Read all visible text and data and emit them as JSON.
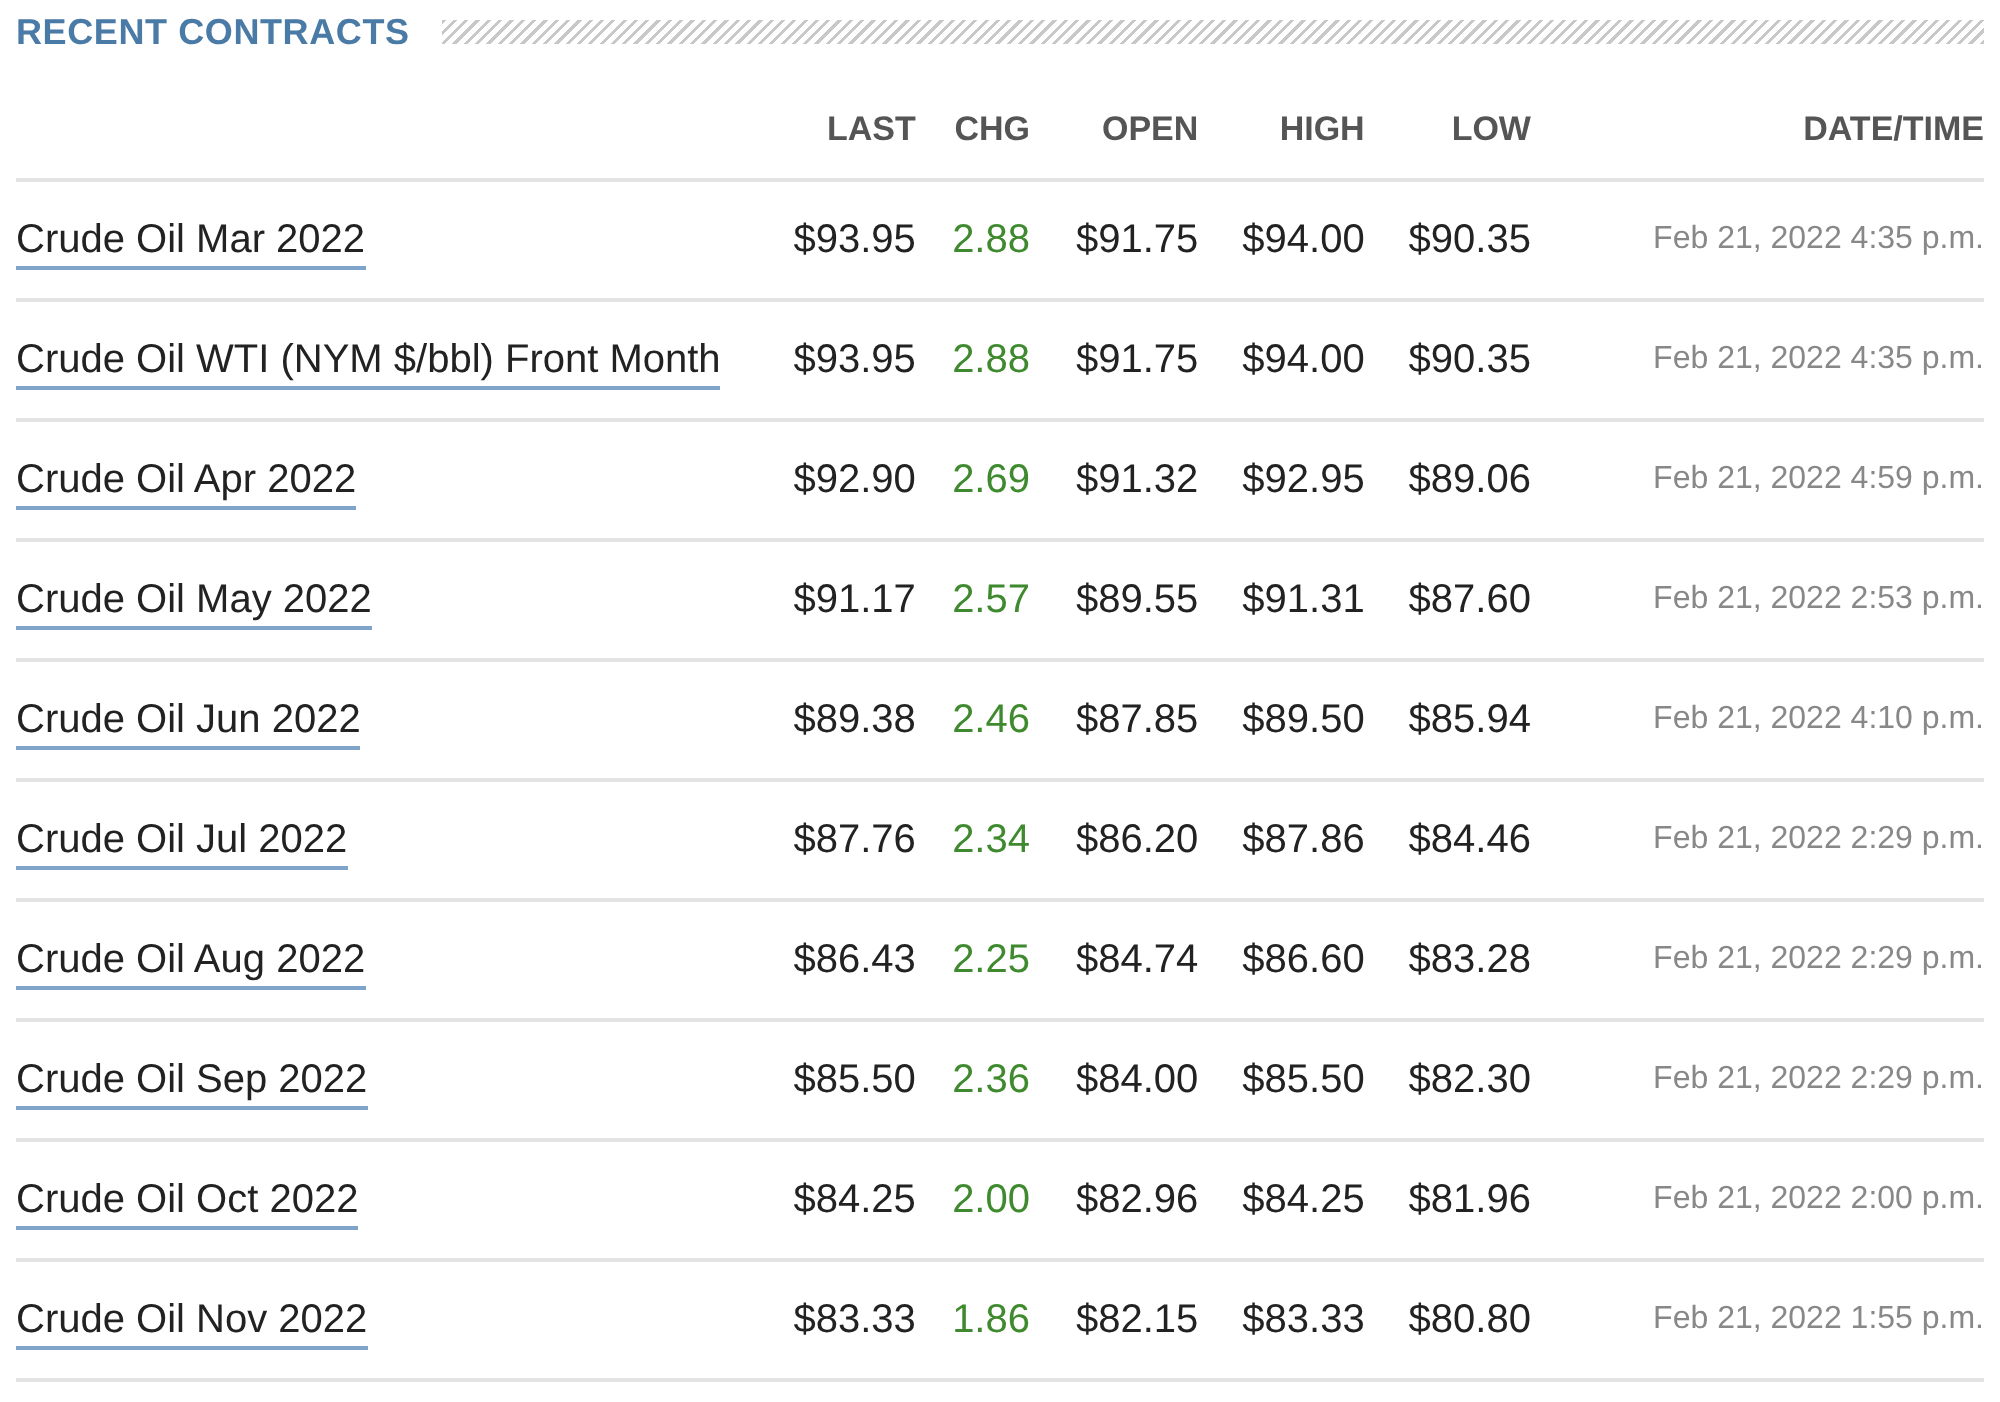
{
  "section_title": "RECENT CONTRACTS",
  "table": {
    "columns": [
      "LAST",
      "CHG",
      "OPEN",
      "HIGH",
      "LOW",
      "DATE/TIME"
    ],
    "rows": [
      {
        "name": "Crude Oil Mar 2022",
        "last": "$93.95",
        "chg": "2.88",
        "open": "$91.75",
        "high": "$94.00",
        "low": "$90.35",
        "datetime": "Feb 21, 2022 4:35 p.m."
      },
      {
        "name": "Crude Oil WTI (NYM $/bbl) Front Month",
        "last": "$93.95",
        "chg": "2.88",
        "open": "$91.75",
        "high": "$94.00",
        "low": "$90.35",
        "datetime": "Feb 21, 2022 4:35 p.m."
      },
      {
        "name": "Crude Oil Apr 2022",
        "last": "$92.90",
        "chg": "2.69",
        "open": "$91.32",
        "high": "$92.95",
        "low": "$89.06",
        "datetime": "Feb 21, 2022 4:59 p.m."
      },
      {
        "name": "Crude Oil May 2022",
        "last": "$91.17",
        "chg": "2.57",
        "open": "$89.55",
        "high": "$91.31",
        "low": "$87.60",
        "datetime": "Feb 21, 2022 2:53 p.m."
      },
      {
        "name": "Crude Oil Jun 2022",
        "last": "$89.38",
        "chg": "2.46",
        "open": "$87.85",
        "high": "$89.50",
        "low": "$85.94",
        "datetime": "Feb 21, 2022 4:10 p.m."
      },
      {
        "name": "Crude Oil Jul 2022",
        "last": "$87.76",
        "chg": "2.34",
        "open": "$86.20",
        "high": "$87.86",
        "low": "$84.46",
        "datetime": "Feb 21, 2022 2:29 p.m."
      },
      {
        "name": "Crude Oil Aug 2022",
        "last": "$86.43",
        "chg": "2.25",
        "open": "$84.74",
        "high": "$86.60",
        "low": "$83.28",
        "datetime": "Feb 21, 2022 2:29 p.m."
      },
      {
        "name": "Crude Oil Sep 2022",
        "last": "$85.50",
        "chg": "2.36",
        "open": "$84.00",
        "high": "$85.50",
        "low": "$82.30",
        "datetime": "Feb 21, 2022 2:29 p.m."
      },
      {
        "name": "Crude Oil Oct 2022",
        "last": "$84.25",
        "chg": "2.00",
        "open": "$82.96",
        "high": "$84.25",
        "low": "$81.96",
        "datetime": "Feb 21, 2022 2:00 p.m."
      },
      {
        "name": "Crude Oil Nov 2022",
        "last": "$83.33",
        "chg": "1.86",
        "open": "$82.15",
        "high": "$83.33",
        "low": "$80.80",
        "datetime": "Feb 21, 2022 1:55 p.m."
      }
    ]
  }
}
